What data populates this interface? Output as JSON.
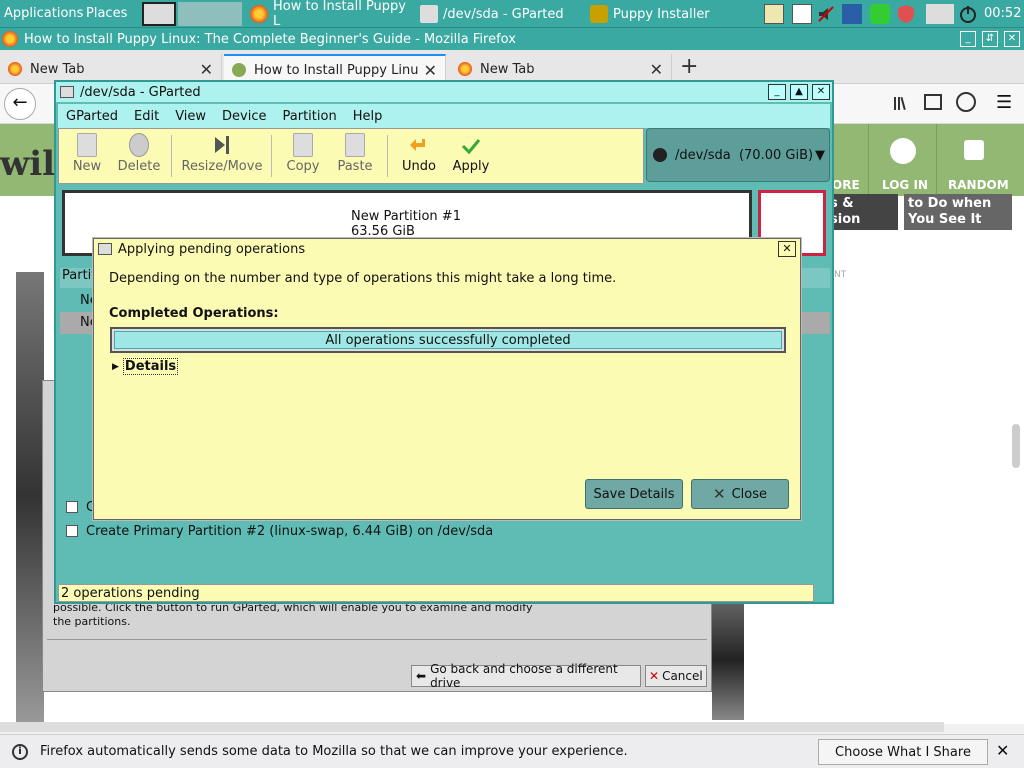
{
  "taskbar": {
    "applications": "Applications",
    "places": "Places",
    "tasks": [
      {
        "label": "How to Install Puppy L"
      },
      {
        "label": "/dev/sda - GParted"
      },
      {
        "label": "Puppy Installer"
      }
    ],
    "clock": "00:52"
  },
  "firefox": {
    "window_title": "How to Install Puppy Linux: The Complete Beginner's Guide - Mozilla Firefox",
    "tabs": [
      {
        "label": "New Tab"
      },
      {
        "label": "How to Install Puppy Linu"
      },
      {
        "label": "New Tab"
      }
    ],
    "wiki_nav": {
      "log_in": "LOG IN",
      "random": "RANDOM",
      "more": "ORE",
      "card_text_1a": "s &",
      "card_text_1b": "sion",
      "card_text_2a": "to Do when",
      "card_text_2b": "You See It",
      "ad_label": "NT"
    },
    "notification": "Firefox automatically sends some data to Mozilla so that we can improve your experience.",
    "notification_button": "Choose What I Share"
  },
  "installer": {
    "text_line1": "possible. Click the button to run GParted, which will enable you to examine and modify",
    "text_line2": "the partitions.",
    "back_button": "Go back and choose a different drive",
    "cancel_button": "Cancel"
  },
  "gparted": {
    "title": "/dev/sda - GParted",
    "menu": [
      {
        "label": "GParted"
      },
      {
        "label": "Edit"
      },
      {
        "label": "View"
      },
      {
        "label": "Device"
      },
      {
        "label": "Partition"
      },
      {
        "label": "Help"
      }
    ],
    "toolbar": {
      "new": "New",
      "delete": "Delete",
      "resize_move": "Resize/Move",
      "copy": "Copy",
      "paste": "Paste",
      "undo": "Undo",
      "apply": "Apply"
    },
    "device": "/dev/sda  (70.00 GiB)",
    "partition_graph": {
      "name": "New Partition #1",
      "size": "63.56 GiB"
    },
    "list_header_fragment": "Partiti",
    "list_row_fragment": "Ne",
    "operations": [
      {
        "label": "Cr"
      },
      {
        "label": "Create Primary Partition #2 (linux-swap, 6.44 GiB) on /dev/sda"
      }
    ],
    "status": "2 operations pending"
  },
  "dialog": {
    "title": "Applying pending operations",
    "description": "Depending on the number and type of operations this might take a long time.",
    "completed_label": "Completed Operations:",
    "progress_text": "All operations successfully completed",
    "progress_value": 1.0,
    "details_label": "Details",
    "save_details": "Save Details",
    "close": "Close"
  }
}
